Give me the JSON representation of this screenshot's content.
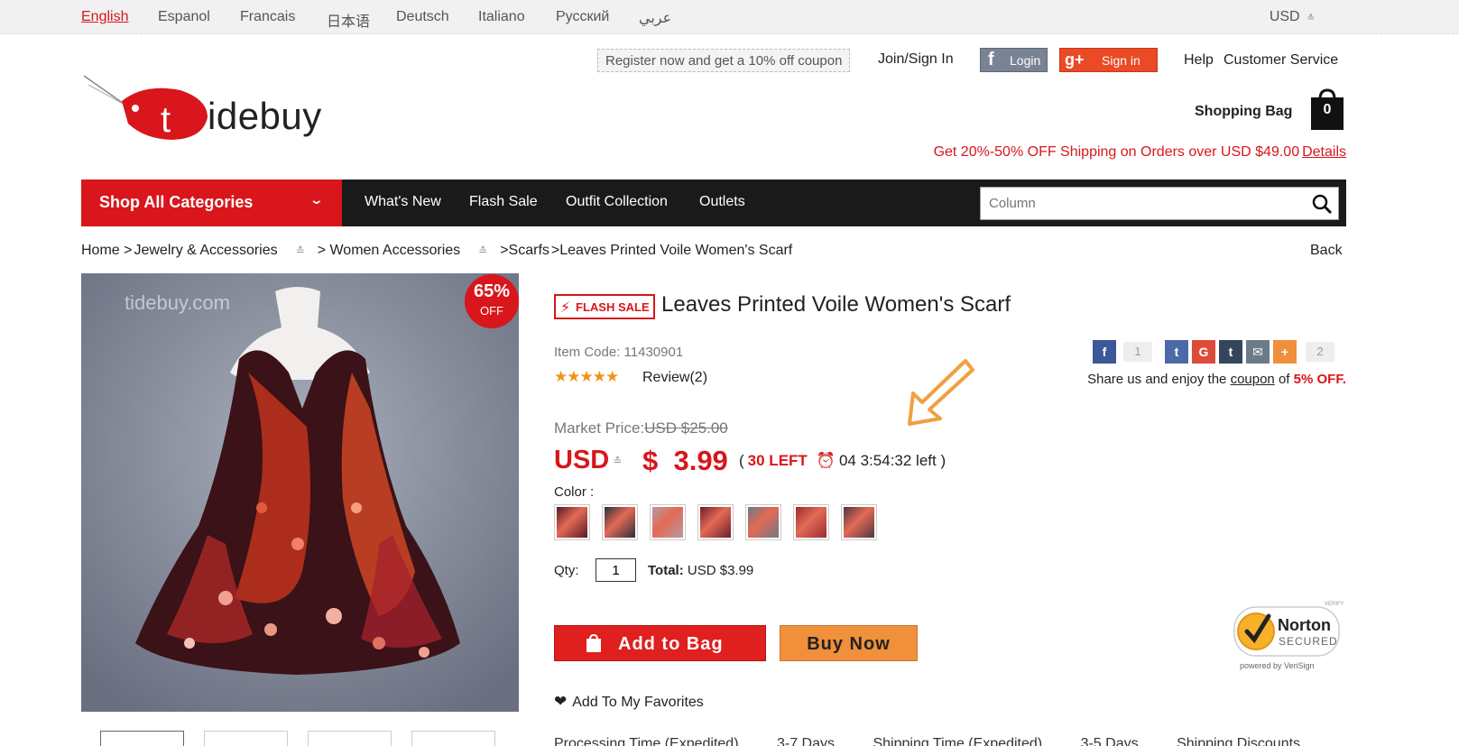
{
  "languages": [
    "English",
    "Espanol",
    "Francais",
    "日本语",
    "Deutsch",
    "Italiano",
    "Русский",
    "عربي"
  ],
  "currency_selector": "USD",
  "header": {
    "logo_text": "idebuy",
    "logo_letter": "t",
    "coupon_text": "Register now and get a 10% off coupon",
    "join_signin": "Join/Sign In",
    "fb_login": "Login",
    "gplus_signin": "Sign in",
    "help": "Help",
    "customer_service": "Customer Service",
    "shopping_bag": "Shopping Bag",
    "bag_count": "0",
    "promo": "Get 20%-50% OFF Shipping on Orders over USD $49.00",
    "promo_link": "Details"
  },
  "nav": {
    "shop_all": "Shop All Categories",
    "links": [
      "What's New",
      "Flash Sale",
      "Outfit Collection",
      "Outlets"
    ],
    "search_placeholder": "Column"
  },
  "breadcrumb": {
    "home": "Home >",
    "jewelry": "Jewelry & Accessories",
    "women": "> Women Accessories",
    "scarfs": ">Scarfs",
    "current": ">Leaves Printed Voile Women's Scarf",
    "back": "Back"
  },
  "product": {
    "image_watermark": "tidebuy.com",
    "discount_pct": "65%",
    "discount_off": "OFF",
    "flash_sale": "FLASH SALE",
    "title": "Leaves Printed Voile Women's Scarf",
    "item_code": "Item Code: 11430901",
    "stars": "★★★★★",
    "review": "Review(2)",
    "market_price_label": "Market Price:",
    "market_price": "USD $25.00",
    "currency": "USD",
    "price": "$  3.99",
    "stock_left": "30 LEFT",
    "timer": "04 3:54:32 left",
    "color_label": "Color :",
    "swatch_colors": [
      "#5a1a22",
      "#2c2f3c",
      "#b79aa2",
      "#6e1f29",
      "#707888",
      "#9b2c32",
      "#4f3642"
    ],
    "qty_label": "Qty:",
    "qty_value": "1",
    "total_label": "Total:",
    "total_value": "USD $3.99",
    "add_to_bag": "Add to Bag",
    "buy_now": "Buy Now",
    "favorites": "Add To My Favorites"
  },
  "share": {
    "fb_count": "1",
    "other_count": "2",
    "text_prefix": "Share us and enjoy the",
    "coupon_link": "coupon",
    "text_of": "of",
    "discount": "5% OFF."
  },
  "norton": {
    "verify": "VERIFY",
    "brand": "Norton",
    "secured": "SECURED",
    "powered": "powered by VeriSign"
  },
  "bottom": [
    "Processing Time (Expedited)",
    "3-7 Days",
    "Shipping Time (Expedited)",
    "3-5 Days",
    "Shipping Discounts"
  ],
  "colors": {
    "brand_red": "#d8161b",
    "nav_black": "#1a1a1a",
    "buy_orange": "#f0903a",
    "star_orange": "#f29218"
  }
}
